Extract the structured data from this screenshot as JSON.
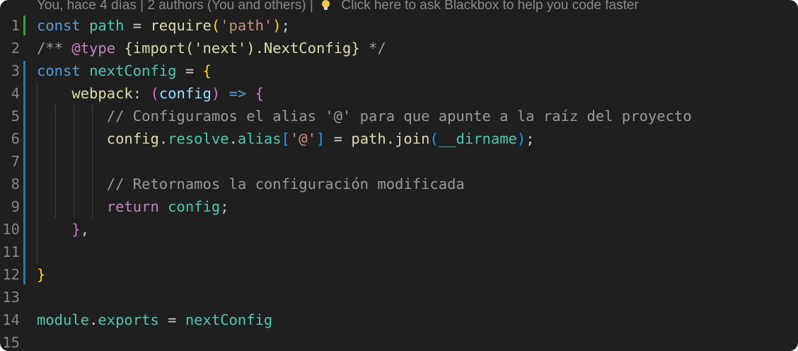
{
  "codelens": {
    "blame": "You, hace 4 días | 2 authors (You and others) |",
    "blackbox": "Click here to ask Blackbox to help you code faster",
    "bulb_icon": "lightbulb-icon"
  },
  "editor": {
    "lines": [
      {
        "n": "1",
        "tokens": [
          {
            "t": "const ",
            "c": "t-kw"
          },
          {
            "t": "path",
            "c": "t-cvar"
          },
          {
            "t": " = ",
            "c": "t-plain"
          },
          {
            "t": "require",
            "c": "t-fn"
          },
          {
            "t": "(",
            "c": "t-yel"
          },
          {
            "t": "'path'",
            "c": "t-str"
          },
          {
            "t": ")",
            "c": "t-yel"
          },
          {
            "t": ";",
            "c": "t-plain"
          }
        ]
      },
      {
        "n": "2",
        "tokens": [
          {
            "t": "/** ",
            "c": "t-cmt2"
          },
          {
            "t": "@type",
            "c": "t-ctl"
          },
          {
            "t": " ",
            "c": "t-cmt2"
          },
          {
            "t": "{import('next').NextConfig}",
            "c": "t-fn"
          },
          {
            "t": " */",
            "c": "t-cmt2"
          }
        ]
      },
      {
        "n": "3",
        "tokens": [
          {
            "t": "const ",
            "c": "t-kw"
          },
          {
            "t": "nextConfig",
            "c": "t-cvar"
          },
          {
            "t": " = ",
            "c": "t-plain"
          },
          {
            "t": "{",
            "c": "t-yel"
          }
        ]
      },
      {
        "n": "4",
        "tokens": [
          {
            "t": "    ",
            "c": "t-plain"
          },
          {
            "t": "webpack",
            "c": "t-fn"
          },
          {
            "t": ": ",
            "c": "t-plain"
          },
          {
            "t": "(",
            "c": "t-pur"
          },
          {
            "t": "config",
            "c": "t-param"
          },
          {
            "t": ") ",
            "c": "t-pur"
          },
          {
            "t": "=> ",
            "c": "t-kw"
          },
          {
            "t": "{",
            "c": "t-pur"
          }
        ]
      },
      {
        "n": "5",
        "tokens": [
          {
            "t": "        ",
            "c": "t-plain"
          },
          {
            "t": "// Configuramos el alias '@' para que apunte a la raíz del proyecto",
            "c": "t-cmt2"
          }
        ]
      },
      {
        "n": "6",
        "tokens": [
          {
            "t": "        ",
            "c": "t-plain"
          },
          {
            "t": "config",
            "c": "t-fn"
          },
          {
            "t": ".",
            "c": "t-plain"
          },
          {
            "t": "resolve",
            "c": "t-cvar"
          },
          {
            "t": ".",
            "c": "t-plain"
          },
          {
            "t": "alias",
            "c": "t-cvar"
          },
          {
            "t": "[",
            "c": "t-blue"
          },
          {
            "t": "'@'",
            "c": "t-str"
          },
          {
            "t": "]",
            "c": "t-blue"
          },
          {
            "t": " = ",
            "c": "t-plain"
          },
          {
            "t": "path",
            "c": "t-fn"
          },
          {
            "t": ".",
            "c": "t-plain"
          },
          {
            "t": "join",
            "c": "t-fn"
          },
          {
            "t": "(",
            "c": "t-blue"
          },
          {
            "t": "__dirname",
            "c": "t-cvar"
          },
          {
            "t": ")",
            "c": "t-blue"
          },
          {
            "t": ";",
            "c": "t-plain"
          }
        ]
      },
      {
        "n": "7",
        "tokens": []
      },
      {
        "n": "8",
        "tokens": [
          {
            "t": "        ",
            "c": "t-plain"
          },
          {
            "t": "// Retornamos la configuración modificada",
            "c": "t-cmt2"
          }
        ]
      },
      {
        "n": "9",
        "tokens": [
          {
            "t": "        ",
            "c": "t-plain"
          },
          {
            "t": "return ",
            "c": "t-ctl"
          },
          {
            "t": "config",
            "c": "t-cvar"
          },
          {
            "t": ";",
            "c": "t-plain"
          }
        ]
      },
      {
        "n": "10",
        "tokens": [
          {
            "t": "    ",
            "c": "t-plain"
          },
          {
            "t": "}",
            "c": "t-pur"
          },
          {
            "t": ",",
            "c": "t-plain"
          }
        ]
      },
      {
        "n": "11",
        "tokens": []
      },
      {
        "n": "12",
        "tokens": [
          {
            "t": "}",
            "c": "t-yel"
          }
        ]
      },
      {
        "n": "13",
        "tokens": []
      },
      {
        "n": "14",
        "tokens": [
          {
            "t": "module",
            "c": "t-cvar"
          },
          {
            "t": ".",
            "c": "t-plain"
          },
          {
            "t": "exports",
            "c": "t-cvar"
          },
          {
            "t": " = ",
            "c": "t-plain"
          },
          {
            "t": "nextConfig",
            "c": "t-cvar"
          }
        ]
      },
      {
        "n": "15",
        "tokens": []
      }
    ]
  },
  "colors": {
    "background": "#1f1f1f",
    "line_number": "#858585",
    "git_added": "#2ea043",
    "git_modified": "#1b81a8"
  }
}
